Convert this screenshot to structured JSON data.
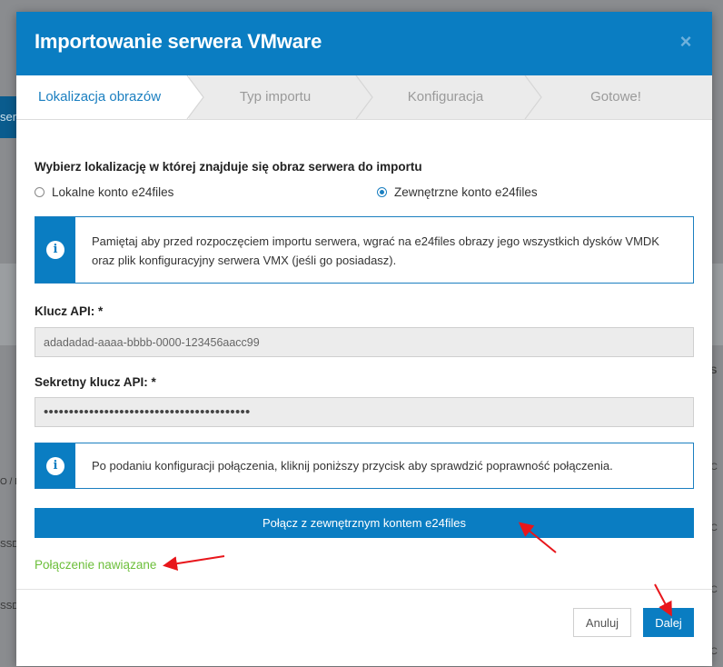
{
  "background": {
    "left_fragment_text": "ser",
    "row_labels": [
      "O / D",
      "SSD /",
      "SSD"
    ],
    "right_fragments": [
      "S",
      "C",
      "C",
      "C",
      "C"
    ]
  },
  "modal": {
    "title": "Importowanie serwera VMware",
    "close_icon": "×"
  },
  "steps": [
    {
      "label": "Lokalizacja obrazów",
      "active": true
    },
    {
      "label": "Typ importu",
      "active": false
    },
    {
      "label": "Konfiguracja",
      "active": false
    },
    {
      "label": "Gotowe!",
      "active": false
    }
  ],
  "location": {
    "heading": "Wybierz lokalizację w której znajduje się obraz serwera do importu",
    "options": [
      {
        "label": "Lokalne konto e24files",
        "checked": false
      },
      {
        "label": "Zewnętrzne konto e24files",
        "checked": true
      }
    ]
  },
  "info1": {
    "icon": "info-icon",
    "text": "Pamiętaj aby przed rozpoczęciem importu serwera, wgrać na e24files obrazy jego wszystkich dysków VMDK oraz plik konfiguracyjny serwera VMX (jeśli go posiadasz)."
  },
  "api_key": {
    "label": "Klucz API: *",
    "value": "adadadad-aaaa-bbbb-0000-123456aacc99"
  },
  "secret_key": {
    "label": "Sekretny klucz API: *",
    "value": "•••••••••••••••••••••••••••••••••••••••••"
  },
  "info2": {
    "icon": "info-icon",
    "text": "Po podaniu konfiguracji połączenia, kliknij poniższy przycisk aby sprawdzić poprawność połączenia."
  },
  "connect_button": "Połącz z zewnętrznym kontem e24files",
  "status_text": "Połączenie nawiązane",
  "footer": {
    "cancel_label": "Anuluj",
    "next_label": "Dalej"
  },
  "colors": {
    "primary": "#0a7dc2",
    "success": "#6cbf3a",
    "annotation": "#e8161b"
  }
}
